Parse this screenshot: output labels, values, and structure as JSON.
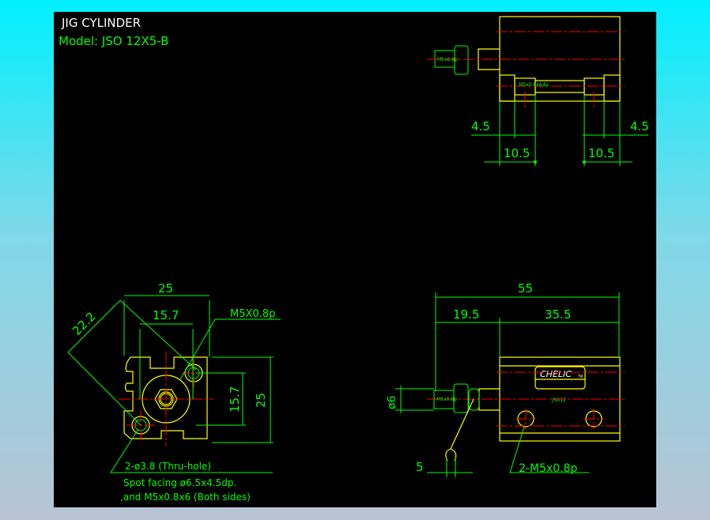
{
  "title": "JIG CYLINDER",
  "model": "Model:  JSO 12X5-B",
  "colors": {
    "background": "#000000",
    "outline": "#ffff00",
    "dimension": "#00ff00",
    "centerline": "#ff0000",
    "title": "#ffffff"
  },
  "side_view": {
    "port_label": "M5x0.8p",
    "port_depth_label": "M5x0.8x6dp.",
    "dims": {
      "left_small": "4.5",
      "right_small": "4.5",
      "left_large": "10.5",
      "right_large": "10.5"
    }
  },
  "front_view": {
    "dims": {
      "width": "25",
      "inner_width": "15.7",
      "diagonal": "22.2",
      "inner_height": "15.7",
      "height": "25"
    },
    "port_callout": "M5X0.8p",
    "hole_note": "2-ø3.8 (Thru-hole)",
    "note_line1": "Spot facing  ø6.5x4.5dp.",
    "note_line2": ",and M5x0.8x6 (Both sides)"
  },
  "top_view": {
    "dims": {
      "total": "55",
      "rod": "19.5",
      "body": "35.5",
      "rod_dia": "ø6",
      "wrench": "5"
    },
    "brand": "CHELIC",
    "brand_suffix": "TW",
    "model_marking": "JSO12",
    "port_label": "M5x0.8p",
    "hole_callout": "2-M5x0.8p"
  }
}
